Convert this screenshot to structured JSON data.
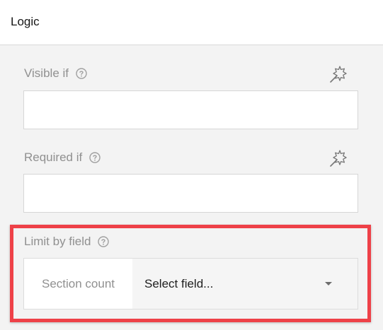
{
  "header": {
    "title": "Logic"
  },
  "properties": {
    "visible_if": {
      "label": "Visible if",
      "value": ""
    },
    "required_if": {
      "label": "Required if",
      "value": ""
    },
    "limit_by_field": {
      "label": "Limit by field",
      "prefix": "Section count",
      "select_value": "Select field..."
    }
  },
  "icons": {
    "help": "help-circle-icon",
    "wand": "magic-wand-icon",
    "dropdown": "chevron-down-icon"
  },
  "colors": {
    "highlight": "#ee4148",
    "label": "#909090",
    "text": "#202020"
  }
}
